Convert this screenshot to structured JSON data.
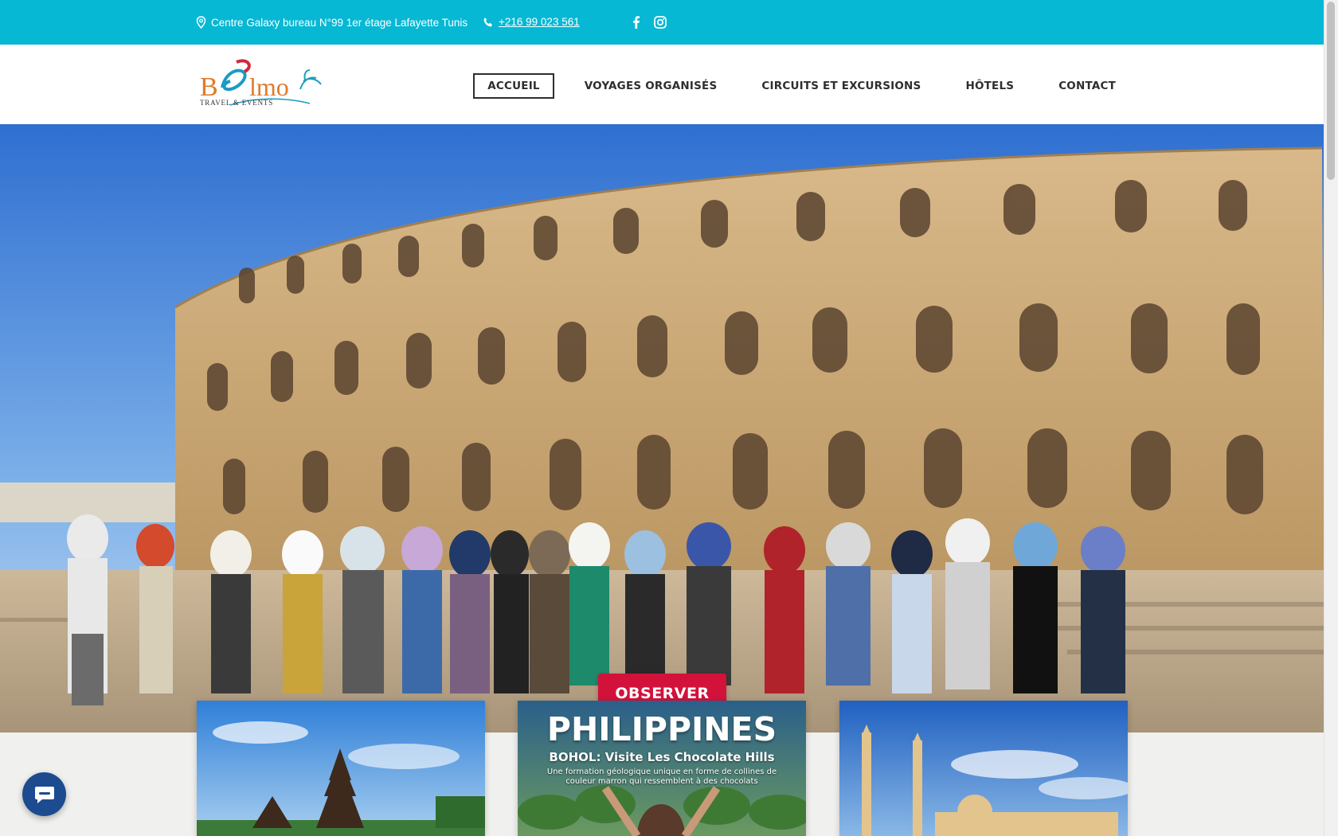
{
  "topbar": {
    "address": "Centre Galaxy bureau N°99 1er étage Lafayette Tunis",
    "phone": "+216 99 023 561",
    "social_icons": [
      "facebook-icon",
      "instagram-icon"
    ]
  },
  "header": {
    "logo_text": "Belmo",
    "logo_tagline": "TRAVEL & EVENTS",
    "nav": [
      {
        "label": "ACCUEIL",
        "active": true
      },
      {
        "label": "VOYAGES ORGANISÉS",
        "active": false
      },
      {
        "label": "CIRCUITS ET EXCURSIONS",
        "active": false
      },
      {
        "label": "HÔTELS",
        "active": false
      },
      {
        "label": "CONTACT",
        "active": false
      }
    ]
  },
  "hero": {
    "cta_label": "OBSERVER"
  },
  "cards": [
    {
      "image": "bali-temple"
    },
    {
      "title": "PHILIPPINES",
      "subtitle": "BOHOL:  Visite Les Chocolate Hills",
      "description": "Une formation géologique unique en forme de collines de couleur marron qui ressemblent à des chocolats"
    },
    {
      "image": "mosque"
    }
  ],
  "colors": {
    "topbar": "#06b8d4",
    "cta": "#d3123b",
    "chat": "#1c4b8f"
  }
}
